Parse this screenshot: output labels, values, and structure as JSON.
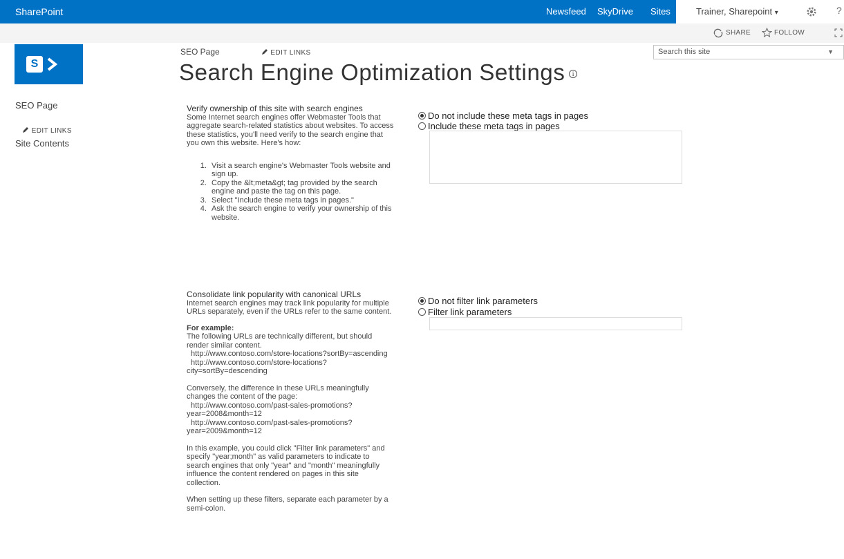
{
  "suite": {
    "brand": "SharePoint",
    "nav": [
      "Newsfeed",
      "SkyDrive",
      "Sites"
    ],
    "user": "Trainer, Sharepoint",
    "user_caret": "▾",
    "help_glyph": "?"
  },
  "actions": {
    "share": "SHARE",
    "follow": "FOLLOW"
  },
  "logo": {
    "letter": "S",
    "color": "#0072c6"
  },
  "breadcrumb": {
    "site": "SEO Page",
    "edit_links": "EDIT LINKS"
  },
  "search": {
    "placeholder": "Search this site"
  },
  "page_title": "Search Engine Optimization Settings",
  "leftnav": {
    "items": [
      "SEO Page",
      "Site Contents"
    ],
    "edit_links": "EDIT LINKS"
  },
  "section1": {
    "heading": "Verify ownership of this site with search engines",
    "description": "Some Internet search engines offer Webmaster Tools that aggregate search-related statistics about websites. To access these statistics, you'll need verify to the search engine that you own this website. Here's how:",
    "steps": [
      "Visit a search engine's Webmaster Tools website and sign up.",
      "Copy the &lt;meta&gt; tag provided by the search engine and paste the tag on this page.",
      "Select \"Include these meta tags in pages.\"",
      "Ask the search engine to verify your ownership of this website."
    ],
    "options": [
      {
        "label": "Do not include these meta tags in pages",
        "checked": true
      },
      {
        "label": "Include these meta tags in pages",
        "checked": false
      }
    ]
  },
  "section2": {
    "heading": "Consolidate link popularity with canonical URLs",
    "description": "Internet search engines may track link popularity for multiple URLs separately, even if the URLs refer to the same content.",
    "example_heading": "For example:",
    "example_intro": "The following URLs are technically different, but should render similar content.",
    "example_urls_1": [
      "http://www.contoso.com/store-locations?sortBy=ascending",
      "http://www.contoso.com/store-locations?city=sortBy=descending"
    ],
    "conversely": "Conversely, the difference in these URLs meaningfully changes the content of the page:",
    "example_urls_2": [
      "http://www.contoso.com/past-sales-promotions?year=2008&month=12",
      "http://www.contoso.com/past-sales-promotions?year=2009&month=12"
    ],
    "example_explain": "In this example, you could click \"Filter link parameters\" and specify \"year;month\" as valid parameters to indicate to search engines that only \"year\" and \"month\" meaningfully influence the content rendered on pages in this site collection.",
    "filters_note": "When setting up these filters, separate each parameter by a semi-colon.",
    "options": [
      {
        "label": "Do not filter link parameters",
        "checked": true
      },
      {
        "label": "Filter link parameters",
        "checked": false
      }
    ]
  }
}
